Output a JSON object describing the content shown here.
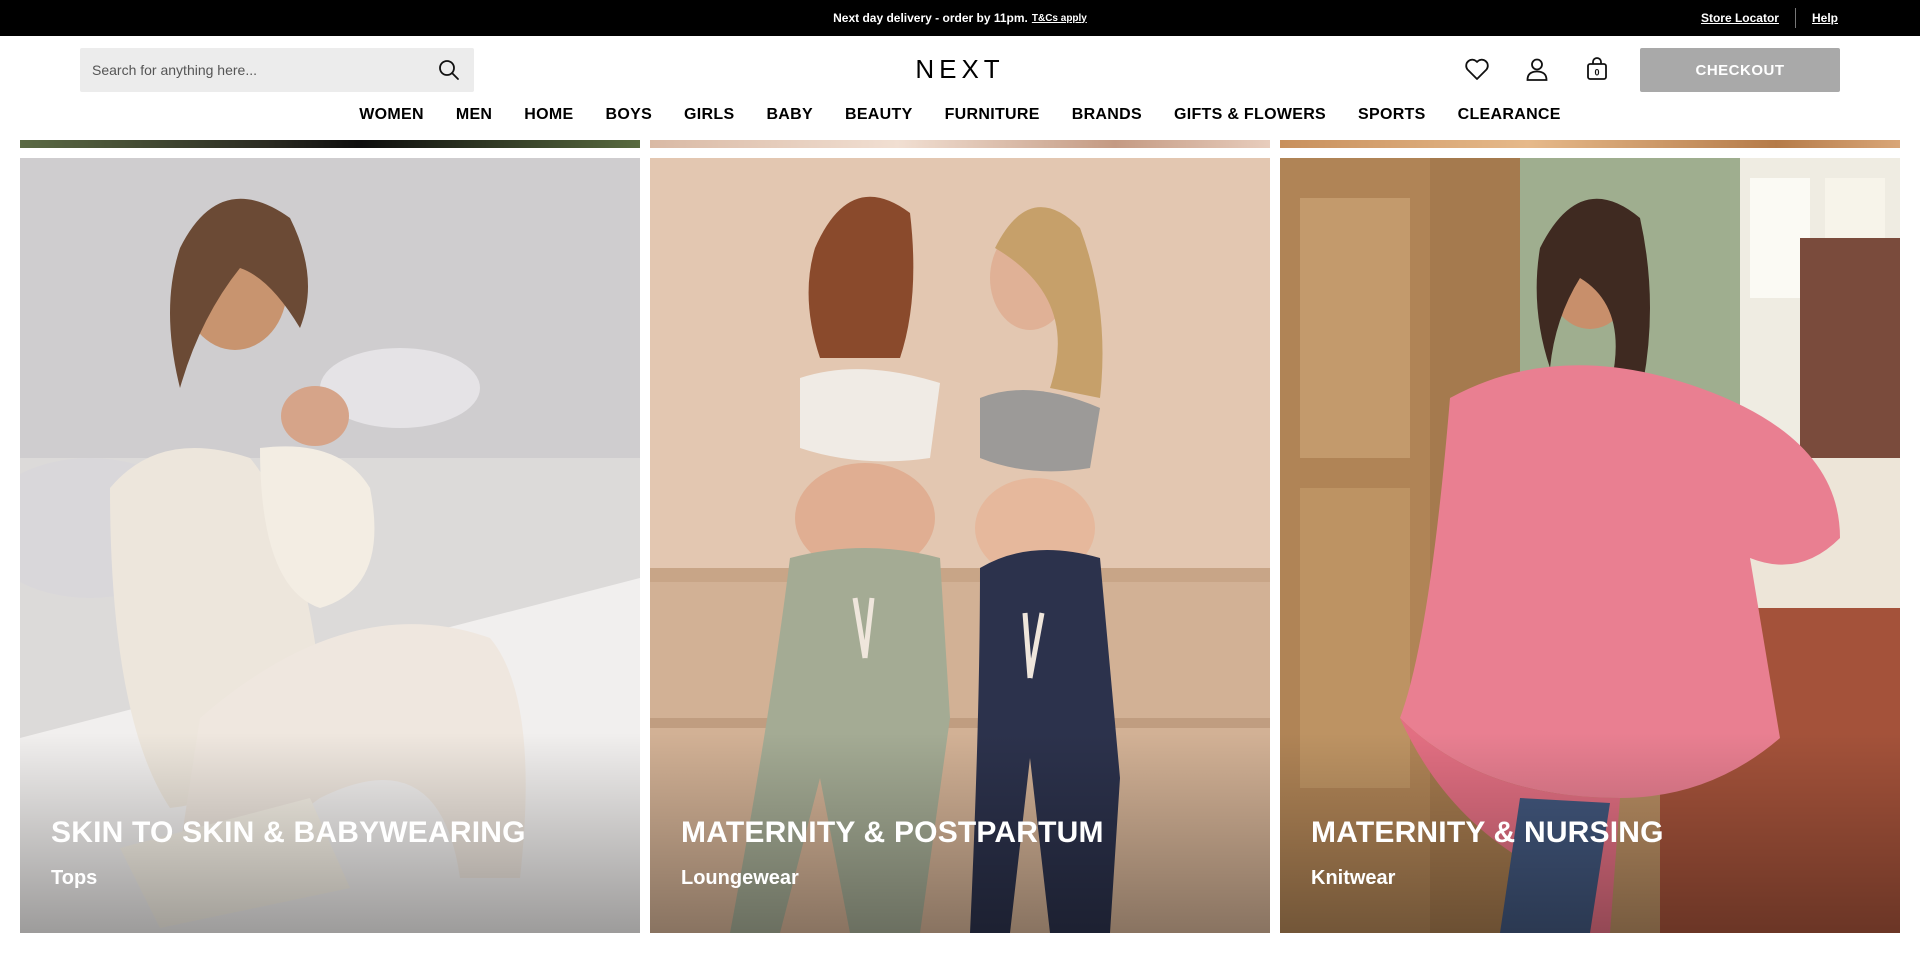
{
  "promo": {
    "text": "Next day delivery - order by 11pm.",
    "tc": "T&Cs apply"
  },
  "top_links": {
    "store_locator": "Store Locator",
    "help": "Help"
  },
  "search": {
    "placeholder": "Search for anything here..."
  },
  "logo": "NEXT",
  "bag": {
    "count": "0"
  },
  "checkout_label": "CHECKOUT",
  "nav": [
    "WOMEN",
    "MEN",
    "HOME",
    "BOYS",
    "GIRLS",
    "BABY",
    "BEAUTY",
    "FURNITURE",
    "BRANDS",
    "GIFTS & FLOWERS",
    "SPORTS",
    "CLEARANCE"
  ],
  "tiles": [
    {
      "title": "SKIN TO SKIN & BABYWEARING",
      "subtitle": "Tops"
    },
    {
      "title": "MATERNITY & POSTPARTUM",
      "subtitle": "Loungewear"
    },
    {
      "title": "MATERNITY & NURSING",
      "subtitle": "Knitwear"
    }
  ],
  "colors": {
    "topbar": "#000000",
    "checkout": "#a9a9a9",
    "search_bg": "#ececec"
  },
  "icons": [
    "search-icon",
    "heart-icon",
    "account-icon",
    "bag-icon"
  ]
}
